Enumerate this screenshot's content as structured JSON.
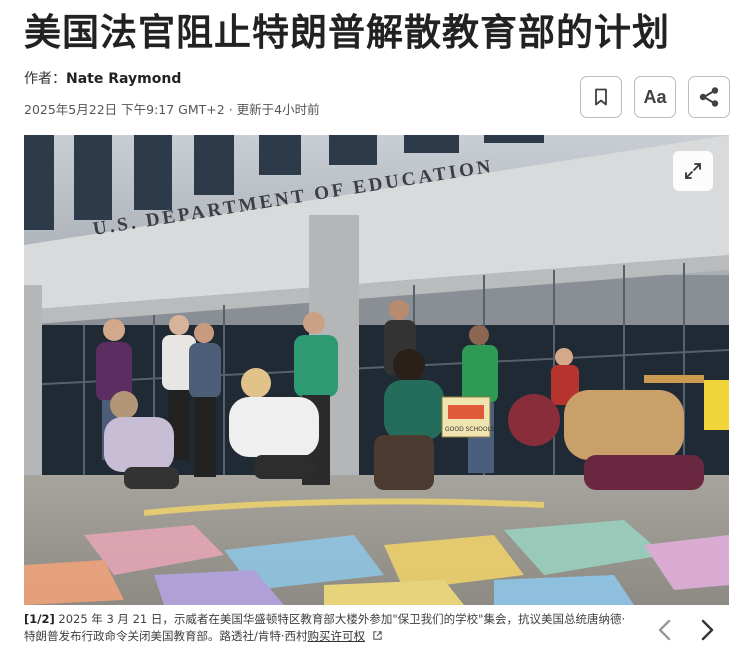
{
  "article": {
    "headline": "美国法官阻止特朗普解散教育部的计划",
    "byline_prefix": "作者：",
    "author": "Nate Raymond",
    "dateline": "2025年5月22日 下午9:17 GMT+2 · 更新于4小时前"
  },
  "toolbar": {
    "bookmark_icon": "bookmark-icon",
    "font_label": "Aa",
    "share_icon": "share-icon"
  },
  "photo": {
    "building_sign": "U.S. DEPARTMENT OF EDUCATION",
    "protest_sign": "GOOD SCHOOLS",
    "expand_icon": "expand-icon"
  },
  "caption": {
    "index": "[1/2]",
    "text": " 2025 年 3 月 21 日，示威者在美国华盛顿特区教育部大楼外参加\"保卫我们的学校\"集会，抗议美国总统唐纳德·特朗普发布行政命令关闭美国教育部。路透社/肯特·西村",
    "license_link": "购买许可权"
  },
  "gallery_nav": {
    "prev_icon": "chevron-left-icon",
    "next_icon": "chevron-right-icon"
  }
}
